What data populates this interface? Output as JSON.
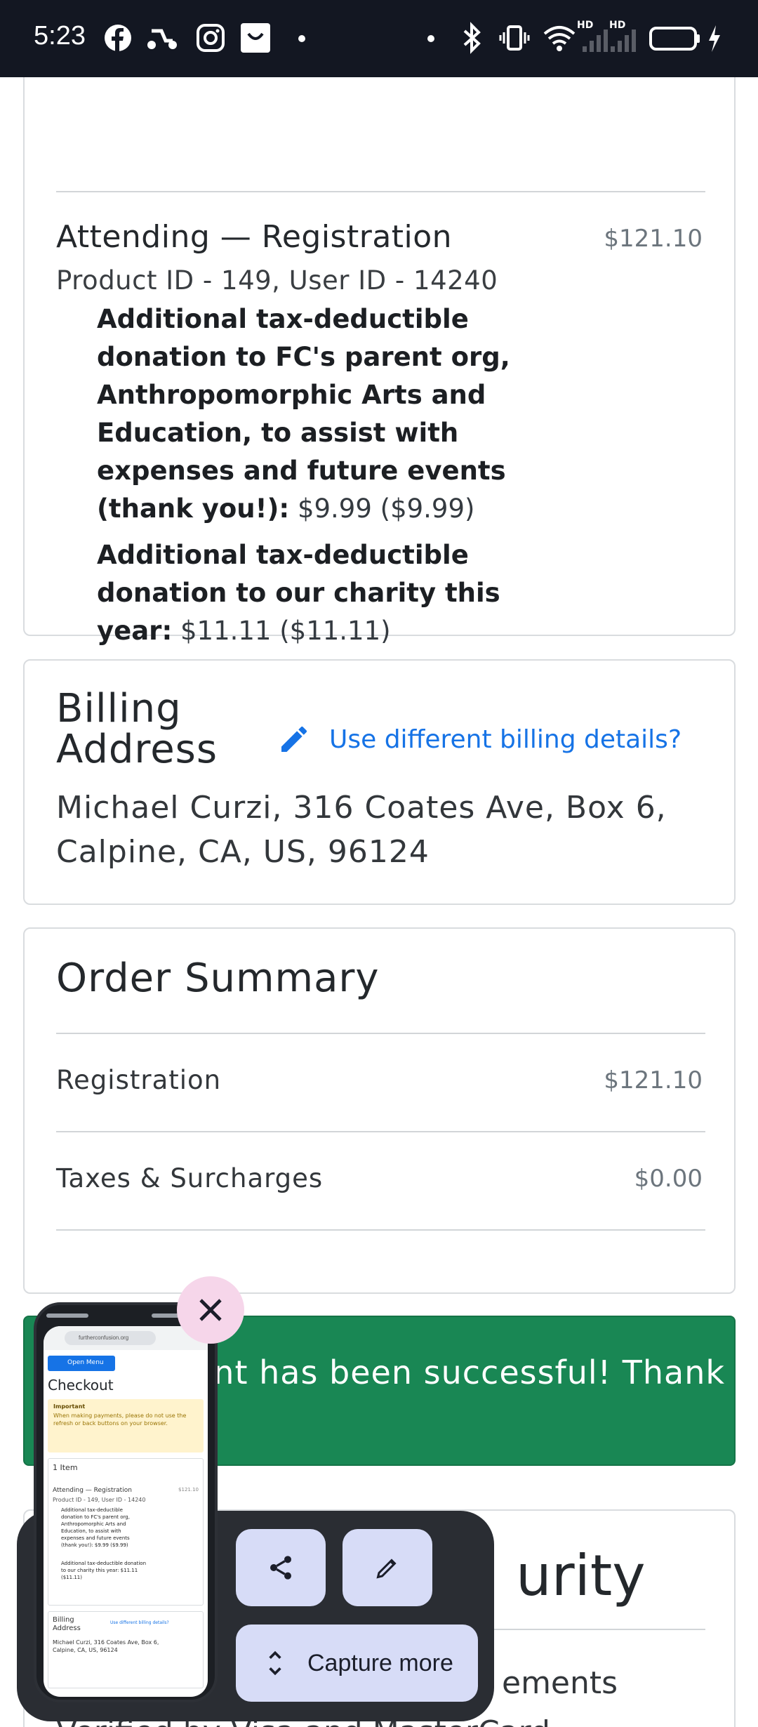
{
  "status_bar": {
    "time": "5:23",
    "icons": [
      "facebook-icon",
      "scooter-icon",
      "instagram-icon",
      "shopping-bag-icon",
      "bluetooth-icon",
      "vibrate-icon",
      "wifi-icon",
      "signal-icon",
      "battery-icon"
    ],
    "hd1": "HD",
    "hd2": "HD"
  },
  "item": {
    "title": "Attending — Registration",
    "price": "$121.10",
    "ids": "Product ID - 149, User ID - 14240",
    "options": [
      {
        "label": "Additional tax-deductible donation to FC's parent org, Anthropomorphic Arts and Education, to assist with expenses and future events (thank you!)",
        "value": "$9.99 ($9.99)"
      },
      {
        "label": "Additional tax-deductible donation to our charity this year",
        "value": "$11.11 ($11.11)"
      }
    ]
  },
  "billing": {
    "heading": "Billing Address",
    "link": "Use different billing details?",
    "address": "Michael Curzi, 316 Coates Ave, Box 6, Calpine, CA, US, 96124"
  },
  "summary": {
    "heading": "Order Summary",
    "rows": [
      {
        "label": "Registration",
        "value": "$121.10"
      },
      {
        "label": "Taxes & Surcharges",
        "value": "$0.00"
      }
    ]
  },
  "alert": {
    "text": "ent has been successful! Thank"
  },
  "below": {
    "heading_fragment": "urity",
    "text_fragment": "ements",
    "bottom_fragment": "Verified by Visa and MasterCard"
  },
  "toolbar": {
    "capture_more": "Capture more"
  },
  "thumbnail": {
    "address_bar": "furtherconfusion.org",
    "menu_button": "Open Menu",
    "title": "Checkout",
    "notice_title": "Important",
    "notice_text": "When making payments, please do not use the refresh or back buttons on your browser.",
    "items_count": "1 Item",
    "item_title": "Attending — Registration",
    "item_price": "$121.10",
    "item_ids": "Product ID - 149, User ID - 14240",
    "option1": "Additional tax-deductible donation to FC's parent org, Anthropomorphic Arts and Education, to assist with expenses and future events (thank you!): $9.99 ($9.99)",
    "option2": "Additional tax-deductible donation to our charity this year: $11.11 ($11.11)",
    "billing_heading": "Billing Address",
    "billing_link": "Use different billing details?",
    "billing_address": "Michael Curzi, 316 Coates Ave, Box 6, Calpine, CA, US, 96124"
  }
}
